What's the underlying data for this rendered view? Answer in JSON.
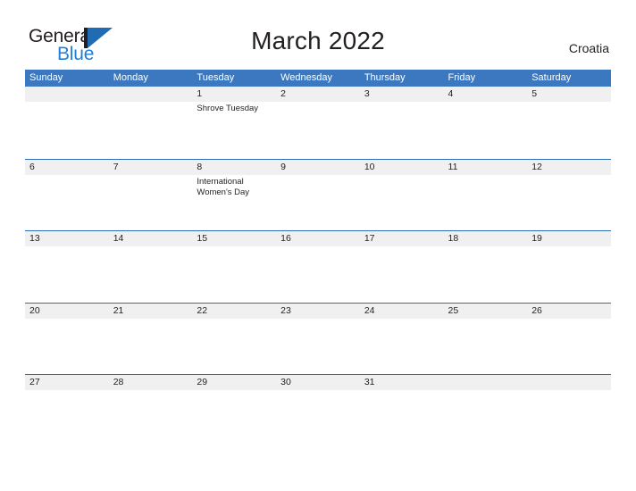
{
  "brand": {
    "name_part1": "General",
    "name_part2": "Blue",
    "mark_icon": "flag-triangle-icon",
    "color_dark": "#231f20",
    "color_blue": "#1f7fd4"
  },
  "header": {
    "title": "March 2022",
    "region": "Croatia"
  },
  "calendar": {
    "accent_header_color": "#3b78bf",
    "row_border_color": "#2c6db5",
    "band_color": "#f0f0f0",
    "weekdays": [
      "Sunday",
      "Monday",
      "Tuesday",
      "Wednesday",
      "Thursday",
      "Friday",
      "Saturday"
    ],
    "weeks": [
      {
        "days": [
          {
            "num": "",
            "events": []
          },
          {
            "num": "",
            "events": []
          },
          {
            "num": "1",
            "events": [
              "Shrove Tuesday"
            ]
          },
          {
            "num": "2",
            "events": []
          },
          {
            "num": "3",
            "events": []
          },
          {
            "num": "4",
            "events": []
          },
          {
            "num": "5",
            "events": []
          }
        ]
      },
      {
        "days": [
          {
            "num": "6",
            "events": []
          },
          {
            "num": "7",
            "events": []
          },
          {
            "num": "8",
            "events": [
              "International Women's Day"
            ]
          },
          {
            "num": "9",
            "events": []
          },
          {
            "num": "10",
            "events": []
          },
          {
            "num": "11",
            "events": []
          },
          {
            "num": "12",
            "events": []
          }
        ]
      },
      {
        "days": [
          {
            "num": "13",
            "events": []
          },
          {
            "num": "14",
            "events": []
          },
          {
            "num": "15",
            "events": []
          },
          {
            "num": "16",
            "events": []
          },
          {
            "num": "17",
            "events": []
          },
          {
            "num": "18",
            "events": []
          },
          {
            "num": "19",
            "events": []
          }
        ]
      },
      {
        "days": [
          {
            "num": "20",
            "events": []
          },
          {
            "num": "21",
            "events": []
          },
          {
            "num": "22",
            "events": []
          },
          {
            "num": "23",
            "events": []
          },
          {
            "num": "24",
            "events": []
          },
          {
            "num": "25",
            "events": []
          },
          {
            "num": "26",
            "events": []
          }
        ]
      },
      {
        "days": [
          {
            "num": "27",
            "events": []
          },
          {
            "num": "28",
            "events": []
          },
          {
            "num": "29",
            "events": []
          },
          {
            "num": "30",
            "events": []
          },
          {
            "num": "31",
            "events": []
          },
          {
            "num": "",
            "events": []
          },
          {
            "num": "",
            "events": []
          }
        ]
      }
    ]
  }
}
